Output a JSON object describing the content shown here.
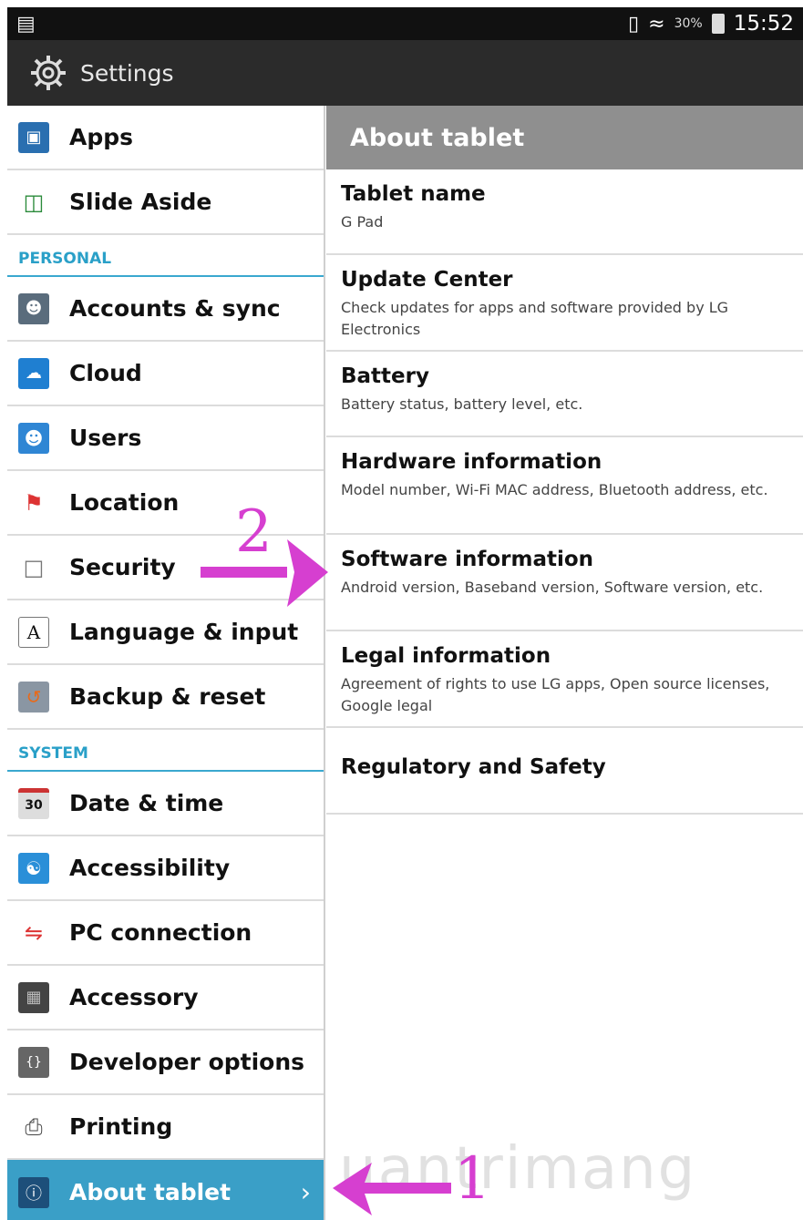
{
  "status_bar": {
    "battery_pct": "30%",
    "time": "15:52"
  },
  "action_bar": {
    "title": "Settings"
  },
  "left_menu": {
    "items_top": [
      {
        "label": "Apps",
        "icon": "apps-icon"
      },
      {
        "label": "Slide Aside",
        "icon": "slide-aside-icon"
      }
    ],
    "section_personal": "PERSONAL",
    "items_personal": [
      {
        "label": "Accounts & sync",
        "icon": "accounts-icon"
      },
      {
        "label": "Cloud",
        "icon": "cloud-icon"
      },
      {
        "label": "Users",
        "icon": "users-icon"
      },
      {
        "label": "Location",
        "icon": "location-icon"
      },
      {
        "label": "Security",
        "icon": "lock-icon"
      },
      {
        "label": "Language & input",
        "icon": "language-icon"
      },
      {
        "label": "Backup & reset",
        "icon": "backup-icon"
      }
    ],
    "section_system": "SYSTEM",
    "items_system": [
      {
        "label": "Date & time",
        "icon": "calendar-icon"
      },
      {
        "label": "Accessibility",
        "icon": "accessibility-icon"
      },
      {
        "label": "PC connection",
        "icon": "pc-connection-icon"
      },
      {
        "label": "Accessory",
        "icon": "accessory-icon"
      },
      {
        "label": "Developer options",
        "icon": "developer-icon"
      },
      {
        "label": "Printing",
        "icon": "printer-icon"
      },
      {
        "label": "About tablet",
        "icon": "about-icon",
        "active": true
      }
    ]
  },
  "right_pane": {
    "header": "About tablet",
    "items": [
      {
        "title": "Tablet name",
        "subtitle": "G Pad"
      },
      {
        "title": "Update Center",
        "subtitle": "Check updates for apps and software provided by LG Electronics"
      },
      {
        "title": "Battery",
        "subtitle": "Battery status, battery level, etc."
      },
      {
        "title": "Hardware information",
        "subtitle": "Model number, Wi-Fi MAC address, Bluetooth address, etc."
      },
      {
        "title": "Software information",
        "subtitle": "Android version, Baseband version, Software version, etc."
      },
      {
        "title": "Legal information",
        "subtitle": "Agreement of rights to use LG apps, Open source licenses, Google legal"
      },
      {
        "title": "Regulatory and Safety",
        "subtitle": ""
      }
    ]
  },
  "annotations": {
    "step1": "1",
    "step2": "2"
  },
  "watermark": "uantrimang",
  "colors": {
    "accent": "#3a9fc7",
    "section": "#2aa0c8",
    "annotation": "#d63fd0",
    "header": "#8f8f8f"
  }
}
